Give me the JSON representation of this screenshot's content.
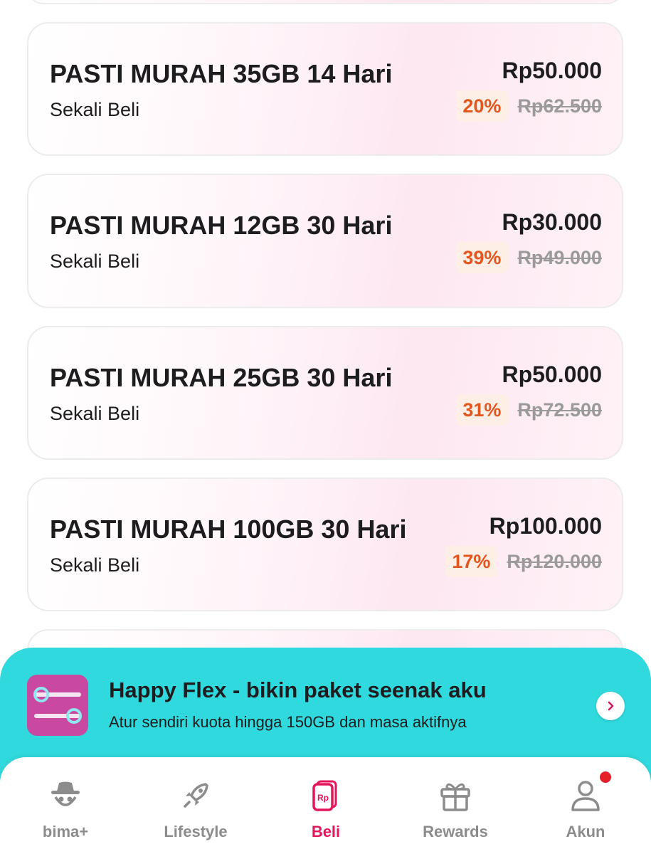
{
  "packages": [
    {
      "name": "PASTI MURAH 35GB 14 Hari",
      "type": "Sekali Beli",
      "price": "Rp50.000",
      "discount": "20%",
      "original_price": "Rp62.500"
    },
    {
      "name": "PASTI MURAH 12GB 30 Hari",
      "type": "Sekali Beli",
      "price": "Rp30.000",
      "discount": "39%",
      "original_price": "Rp49.000"
    },
    {
      "name": "PASTI MURAH 25GB 30 Hari",
      "type": "Sekali Beli",
      "price": "Rp50.000",
      "discount": "31%",
      "original_price": "Rp72.500"
    },
    {
      "name": "PASTI MURAH 100GB 30 Hari",
      "type": "Sekali Beli",
      "price": "Rp100.000",
      "discount": "17%",
      "original_price": "Rp120.000"
    }
  ],
  "banner": {
    "title": "Happy Flex - bikin paket seenak aku",
    "description": "Atur sendiri kuota hingga 150GB dan masa aktifnya",
    "icon": "sliders-icon",
    "background_color": "#2fd9dd"
  },
  "nav": {
    "items": [
      {
        "label": "bima+",
        "icon": "incognito-icon"
      },
      {
        "label": "Lifestyle",
        "icon": "rocket-icon"
      },
      {
        "label": "Beli",
        "icon": "rupiah-cards-icon",
        "active": true
      },
      {
        "label": "Rewards",
        "icon": "gift-icon"
      },
      {
        "label": "Akun",
        "icon": "user-icon",
        "has_notification": true
      }
    ],
    "active_color": "#e3165b",
    "inactive_color": "#8c8c8c"
  },
  "colors": {
    "discount_text": "#e2561f",
    "discount_bg": "#fdeee6",
    "notification_dot": "#e4202a"
  }
}
